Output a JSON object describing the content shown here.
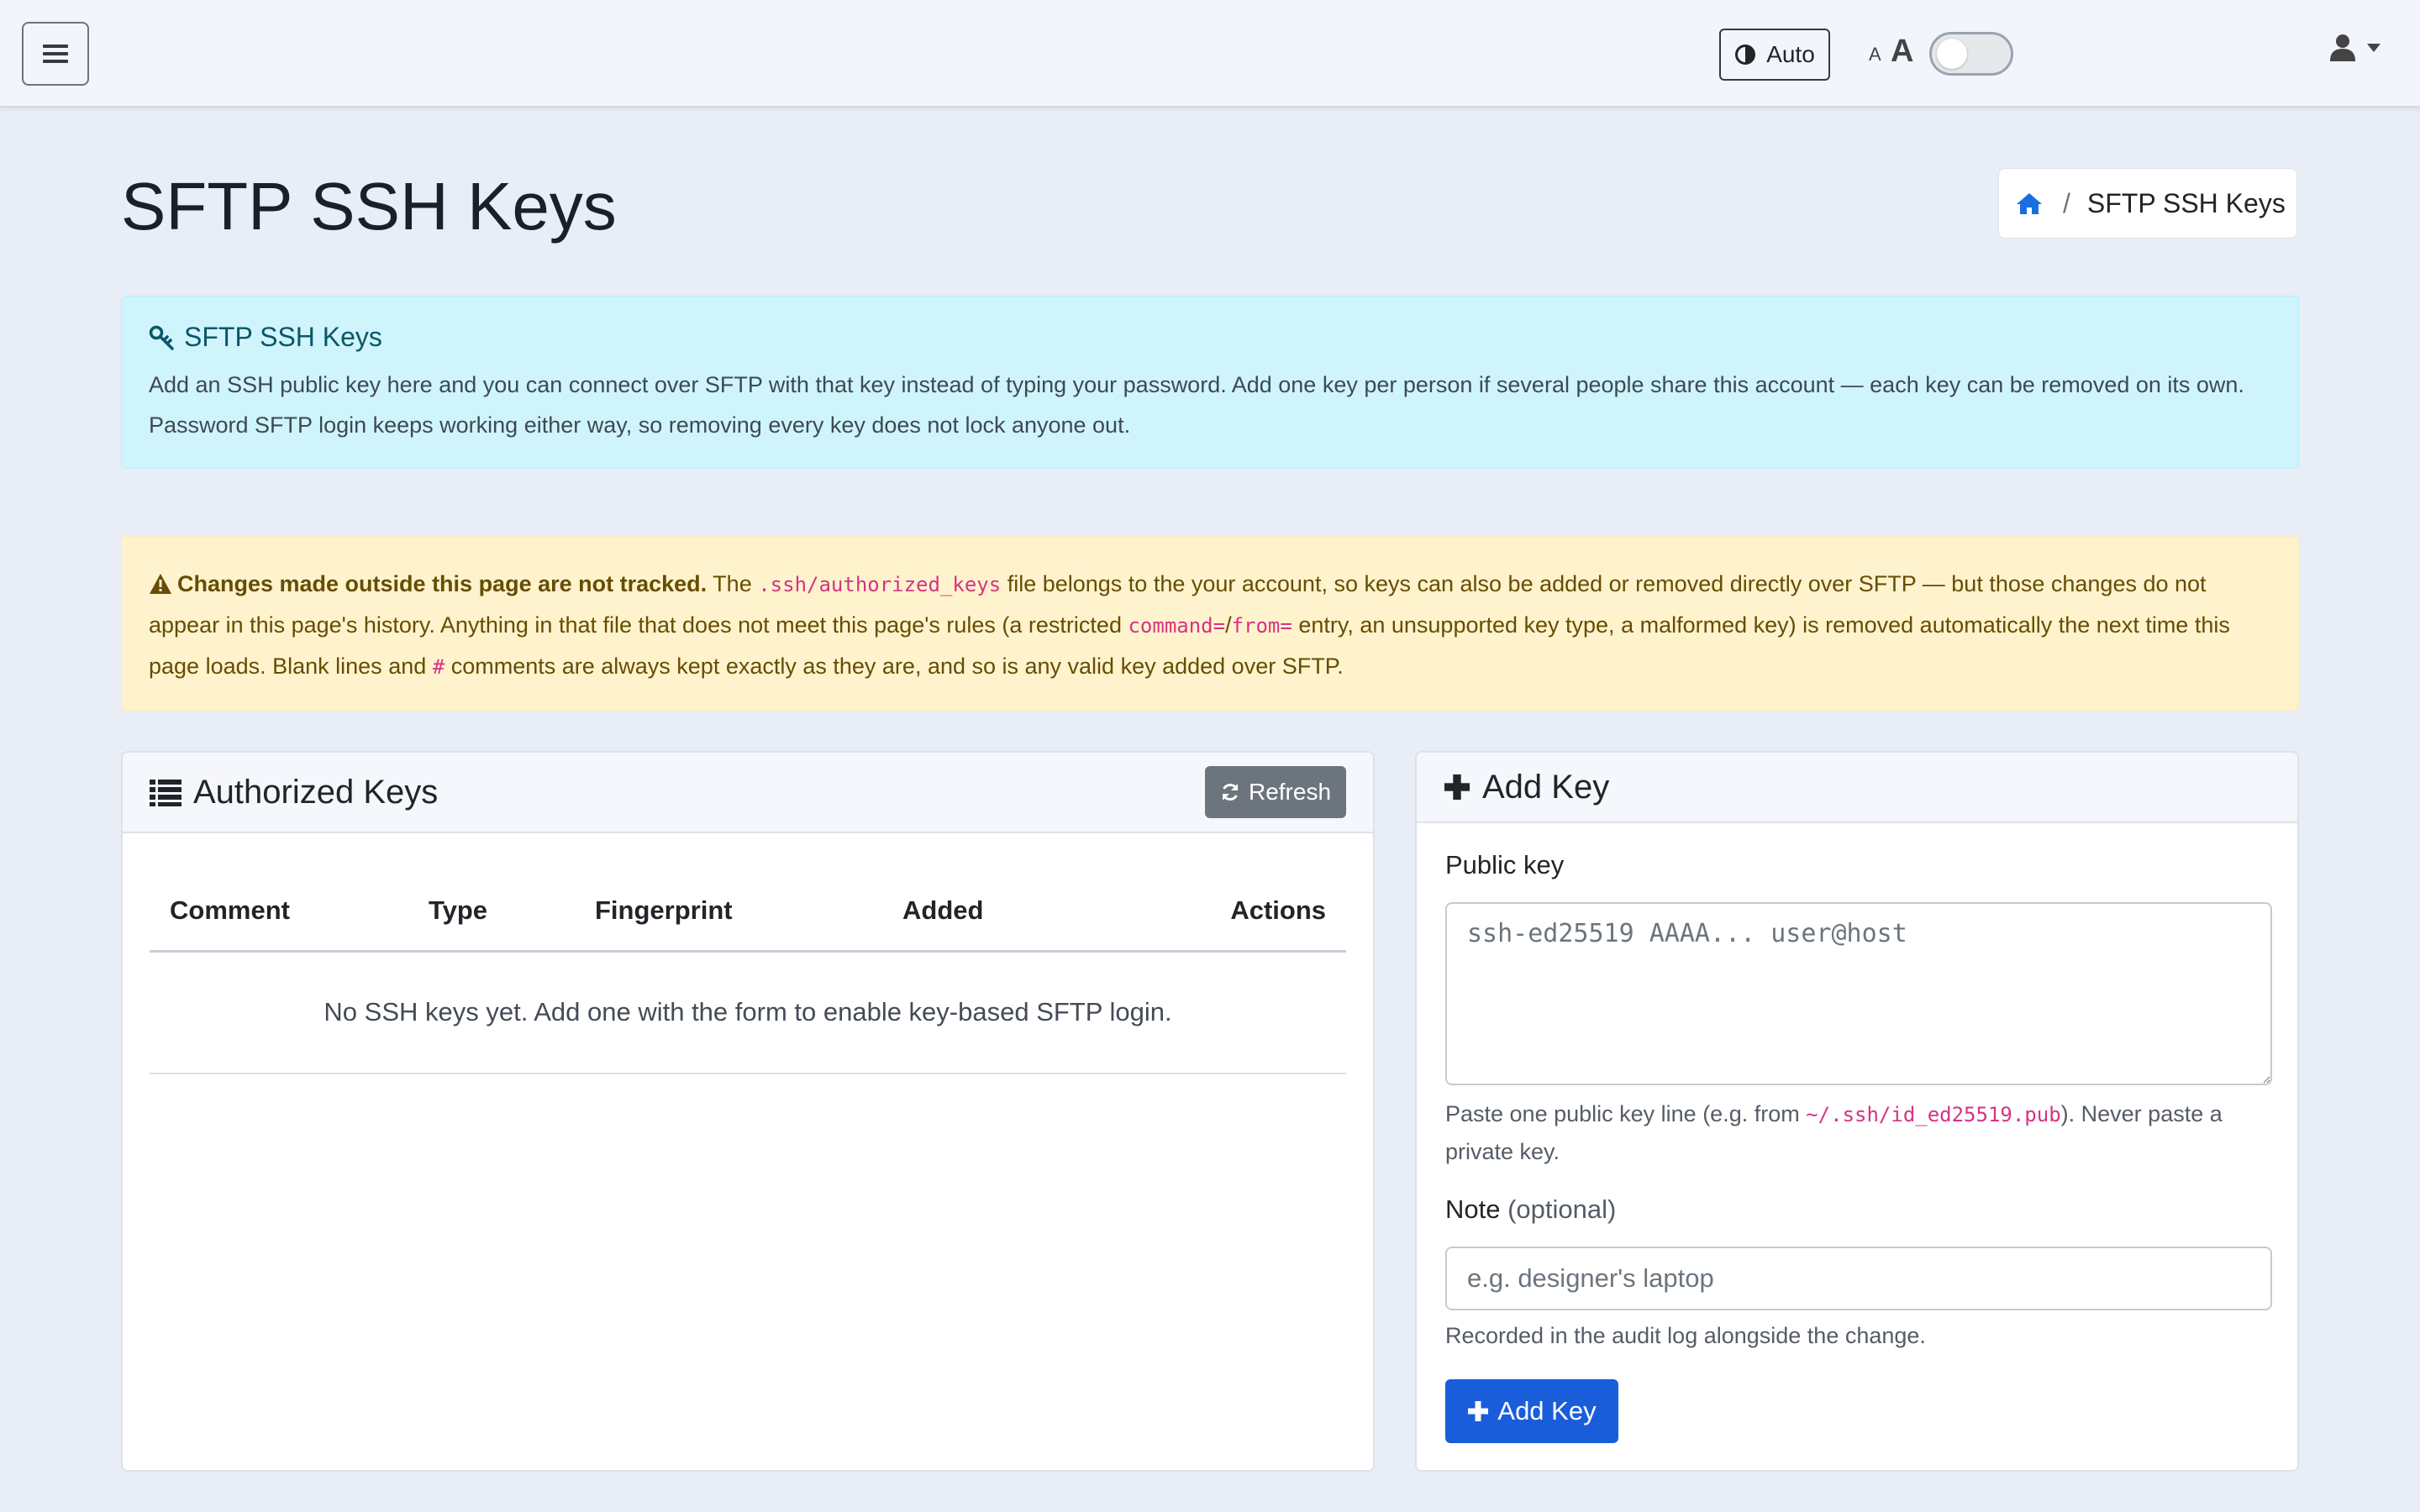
{
  "navbar": {
    "theme_label": "Auto",
    "font_small": "A",
    "font_big": "A"
  },
  "page": {
    "title": "SFTP SSH Keys"
  },
  "breadcrumb": {
    "separator": "/",
    "current": "SFTP SSH Keys"
  },
  "info_alert": {
    "title": "SFTP SSH Keys",
    "body": "Add an SSH public key here and you can connect over SFTP with that key instead of typing your password. Add one key per person if several people share this account — each key can be removed on its own. Password SFTP login keeps working either way, so removing every key does not lock anyone out."
  },
  "warning_alert": {
    "bold": "Changes made outside this page are not tracked.",
    "part1": " The ",
    "code1": ".ssh/authorized_keys",
    "part2": " file belongs to the your account, so keys can also be added or removed directly over SFTP — but those changes do not appear in this page's history. Anything in that file that does not meet this page's rules (a restricted ",
    "code2": "command=",
    "slash": "/",
    "code3": "from=",
    "part3": " entry, an unsupported key type, a malformed key) is removed automatically the next time this page loads. Blank lines and ",
    "code4": "#",
    "part4": " comments are always kept exactly as they are, and so is any valid key added over SFTP."
  },
  "keys_card": {
    "title": "Authorized Keys",
    "refresh_label": "Refresh",
    "columns": [
      "Comment",
      "Type",
      "Fingerprint",
      "Added",
      "Actions"
    ],
    "empty_message": "No SSH keys yet. Add one with the form to enable key-based SFTP login."
  },
  "add_card": {
    "title": "Add Key",
    "public_key_label": "Public key",
    "public_key_placeholder": "ssh-ed25519 AAAA... user@host",
    "public_key_help_1": "Paste one public key line (e.g. from ",
    "public_key_help_code": "~/.ssh/id_ed25519.pub",
    "public_key_help_2": "). Never paste a private key.",
    "note_label": "Note",
    "note_optional": "(optional)",
    "note_placeholder": "e.g. designer's laptop",
    "note_help": "Recorded in the audit log alongside the change.",
    "submit_label": "Add Key"
  },
  "colors": {
    "primary": "#1a5ddb",
    "secondary": "#6c757d",
    "info_bg": "#cff4fc",
    "warning_bg": "#fff3cd",
    "code": "#d63384"
  },
  "icons": {
    "menu": "hamburger-icon",
    "theme": "contrast-icon",
    "user": "user-icon",
    "home": "home-icon",
    "key": "key-icon",
    "warning": "warning-triangle-icon",
    "list": "list-icon",
    "refresh": "refresh-icon",
    "plus": "plus-icon"
  }
}
